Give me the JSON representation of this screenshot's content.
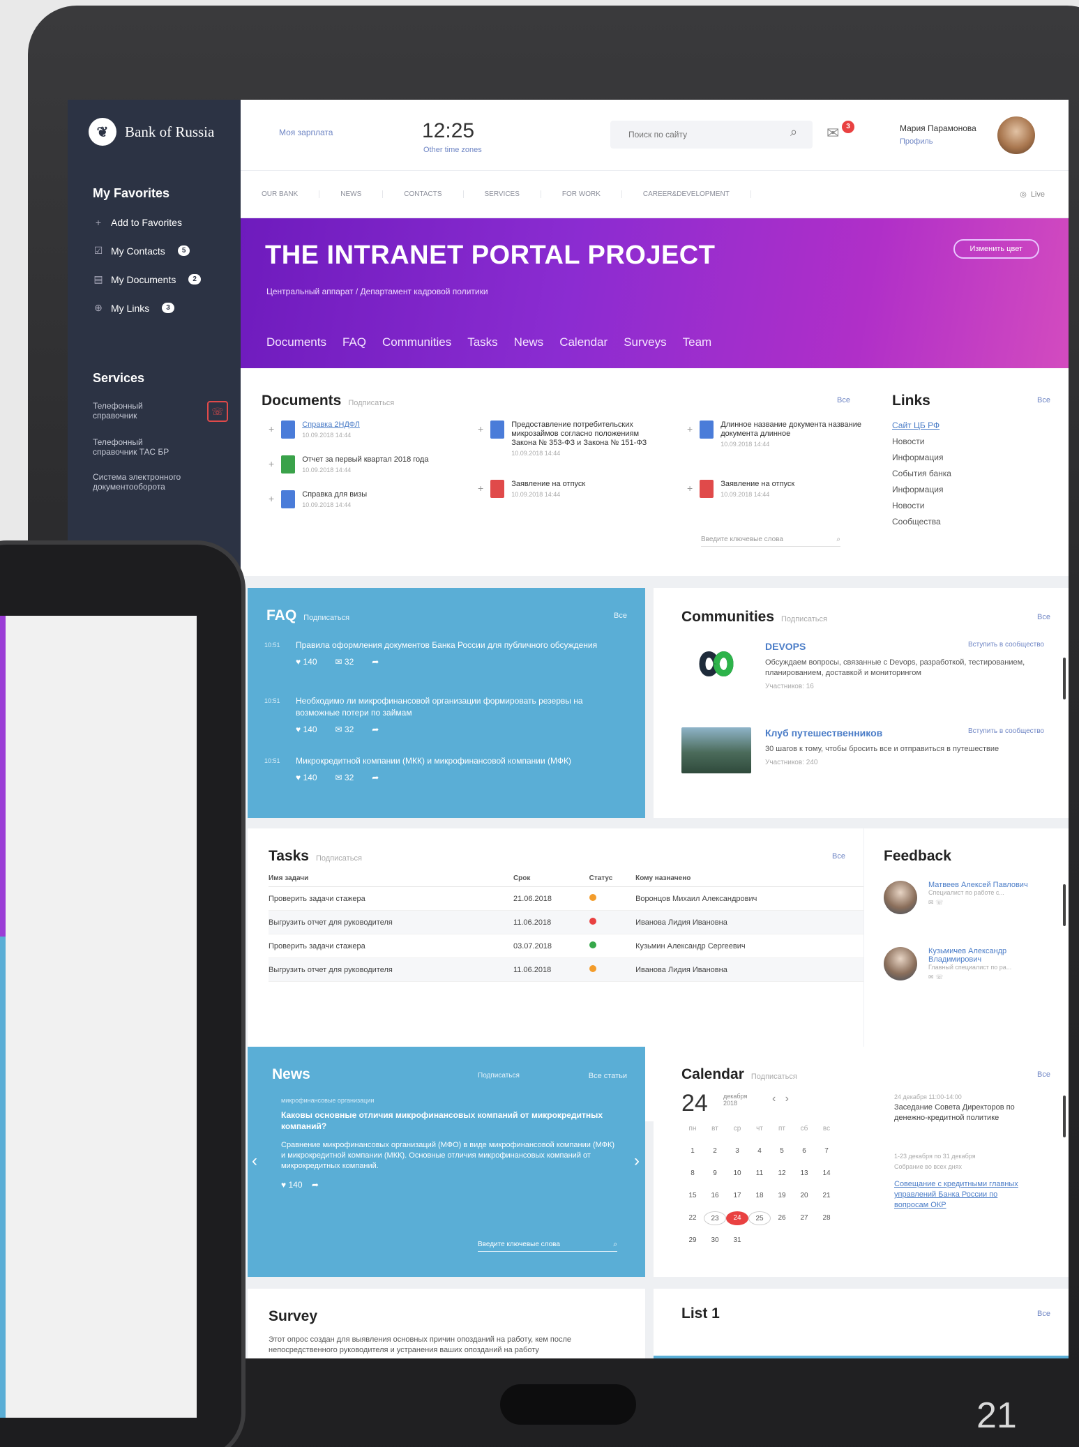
{
  "sidebar": {
    "logo": "Bank of Russia",
    "favorites_title": "My Favorites",
    "favorites": [
      {
        "label": "Add to Favorites",
        "icon": "plus-icon",
        "badge": ""
      },
      {
        "label": "My Contacts",
        "icon": "contacts-icon",
        "badge": "5"
      },
      {
        "label": "My Documents",
        "icon": "documents-icon",
        "badge": "2"
      },
      {
        "label": "My Links",
        "icon": "link-icon",
        "badge": "3"
      }
    ],
    "services_title": "Services",
    "services": [
      "Телефонный справочник",
      "Телефонный справочник ТАС БР",
      "Система электронного документооборота"
    ]
  },
  "topbar": {
    "muted_link": "Моя зарплата",
    "time": "12:25",
    "time_sub": "Other time zones",
    "search_placeholder": "Поиск по сайту",
    "notif_count": "3",
    "user_name": "Мария Парамонова",
    "user_role": "Профиль"
  },
  "nav": {
    "items": [
      "Our bank",
      "News",
      "Contacts",
      "Services",
      "For work",
      "Career&Development"
    ],
    "live": "Live"
  },
  "hero": {
    "title": "THE INTRANET PORTAL PROJECT",
    "subtitle": "Центральный аппарат / Департамент кадровой политики",
    "button": "Изменить цвет",
    "tabs": [
      "Documents",
      "FAQ",
      "Communities",
      "Tasks",
      "News",
      "Calendar",
      "Surveys",
      "Team"
    ]
  },
  "documents": {
    "title": "Documents",
    "sub": "Подписаться",
    "all": "Все",
    "search": "Введите ключевые слова",
    "items": [
      {
        "title": "Справка 2НДФЛ",
        "date": "10.09.2018 14:44"
      },
      {
        "title": "Отчет за первый квартал 2018 года",
        "date": "10.09.2018 14:44"
      },
      {
        "title": "Справка для визы",
        "date": "10.09.2018 14:44"
      },
      {
        "title": "Предоставление потребительских микрозаймов согласно положениям Закона № 353-ФЗ и Закона № 151-ФЗ",
        "date": "10.09.2018 14:44"
      },
      {
        "title": "Заявление на отпуск",
        "date": "10.09.2018 14:44"
      },
      {
        "title": "Длинное название документа название документа длинное",
        "date": "10.09.2018 14:44"
      },
      {
        "title": "Заявление на отпуск",
        "date": "10.09.2018 14:44"
      }
    ]
  },
  "links": {
    "title": "Links",
    "all": "Все",
    "items": [
      "Сайт ЦБ РФ",
      "Новости",
      "Информация",
      "События банка",
      "Информация",
      "Новости",
      "Сообщества"
    ]
  },
  "faq": {
    "title": "FAQ",
    "sub": "Подписаться",
    "all": "Все",
    "items": [
      {
        "time": "10:51",
        "text": "Правила оформления документов Банка России для публичного обсуждения",
        "likes": "140",
        "comments": "32"
      },
      {
        "time": "10:51",
        "text": "Необходимо ли микрофинансовой организации формировать резервы на возможные потери по займам",
        "likes": "140",
        "comments": "32"
      },
      {
        "time": "10:51",
        "text": "Микрокредитной компании (МКК) и микрофинансовой компании (МФК)",
        "likes": "140",
        "comments": "32"
      }
    ]
  },
  "communities": {
    "title": "Communities",
    "sub": "Подписаться",
    "all": "Все",
    "items": [
      {
        "name": "DEVOPS",
        "join": "Вступить в сообщество",
        "desc": "Обсуждаем вопросы, связанные с Devops, разработкой, тестированием, планированием, доставкой и мониторингом",
        "count": "Участников: 16"
      },
      {
        "name": "Клуб путешественников",
        "join": "Вступить в сообщество",
        "desc": "30 шагов к тому, чтобы бросить все и отправиться в путешествие",
        "count": "Участников: 240"
      }
    ]
  },
  "tasks": {
    "title": "Tasks",
    "sub": "Подписаться",
    "all": "Все",
    "headers": [
      "Имя задачи",
      "Срок",
      "Статус",
      "Кому назначено"
    ],
    "rows": [
      {
        "name": "Проверить задачи стажера",
        "due": "21.06.2018",
        "status": "#f39c2b",
        "assignee": "Воронцов Михаил Александрович"
      },
      {
        "name": "Выгрузить отчет для руководителя",
        "due": "11.06.2018",
        "status": "#e94141",
        "assignee": "Иванова Лидия Ивановна"
      },
      {
        "name": "Проверить задачи стажера",
        "due": "03.07.2018",
        "status": "#36a84a",
        "assignee": "Кузьмин Александр Сергеевич"
      },
      {
        "name": "Выгрузить отчет для руководителя",
        "due": "11.06.2018",
        "status": "#f39c2b",
        "assignee": "Иванова Лидия Ивановна"
      }
    ]
  },
  "feedback": {
    "title": "Feedback",
    "items": [
      {
        "name": "Матвеев Алексей Павлович",
        "desc": "Специалист по работе с..."
      },
      {
        "name": "Кузьмичев Александр Владимирович",
        "desc": "Главный специалист по ра..."
      }
    ]
  },
  "news": {
    "title": "News",
    "sub": "Подписаться",
    "all": "Все статьи",
    "tag": "микрофинансовые организации",
    "headline": "Каковы основные отличия микрофинансовых компаний от микрокредитных компаний?",
    "body": "Сравнение микрофинансовых организаций (МФО) в виде микрофинансовой компании (МФК) и микрокредитной компании (МКК). Основные отличия микрофинансовых компаний от микрокредитных компаний.",
    "likes": "140",
    "search": "Введите ключевые слова"
  },
  "calendar": {
    "title": "Calendar",
    "sub": "Подписаться",
    "all": "Все",
    "day": "24",
    "month": "декабря",
    "year": "2018",
    "weekdays": [
      "пн",
      "вт",
      "ср",
      "чт",
      "пт",
      "сб",
      "вс"
    ],
    "days": [
      "1",
      "2",
      "3",
      "4",
      "5",
      "6",
      "7",
      "8",
      "9",
      "10",
      "11",
      "12",
      "13",
      "14",
      "15",
      "16",
      "17",
      "18",
      "19",
      "20",
      "21",
      "22",
      "23",
      "24",
      "25",
      "26",
      "27",
      "28",
      "29",
      "30",
      "31"
    ],
    "selected": "24",
    "events": [
      {
        "time": "24 декабря 11:00-14:00",
        "text": "Заседание Совета Директоров по денежно-кредитной политике"
      },
      {
        "time": "1-23 декабря по 31 декабря",
        "text": "Собрание во всех днях"
      },
      {
        "time": "",
        "text": "Совещание с кредитными главных управлений Банка России по вопросам ОКР"
      }
    ]
  },
  "survey": {
    "title": "Survey",
    "text": "Этот опрос создан для выявления основных причин опозданий на работу, кем после непосредственного руководителя и устранения ваших опозданий на работу"
  },
  "list1": {
    "title": "List 1",
    "all": "Все"
  },
  "page_number": "21"
}
